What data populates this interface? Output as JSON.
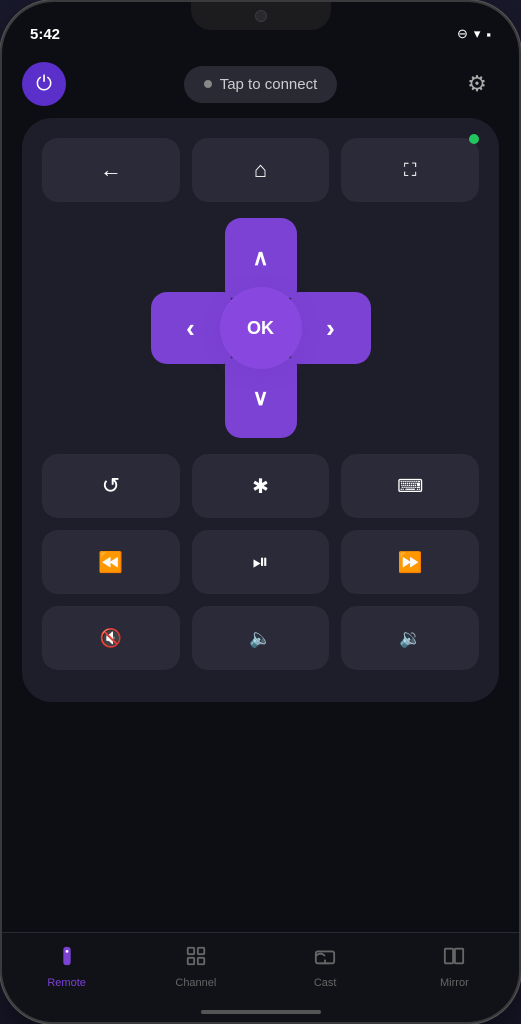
{
  "statusBar": {
    "time": "5:42",
    "icons": [
      "⊖",
      "▾",
      "▪"
    ]
  },
  "header": {
    "tapToConnect": "Tap to connect",
    "powerIcon": "⏻",
    "settingsIcon": "⚙"
  },
  "remote": {
    "navButtons": [
      {
        "icon": "←",
        "name": "back"
      },
      {
        "icon": "⌂",
        "name": "home"
      },
      {
        "icon": "⛶",
        "name": "fullscreen"
      }
    ],
    "dpad": {
      "up": "∧",
      "down": "∨",
      "left": "‹",
      "right": "›",
      "ok": "OK"
    },
    "mediaRow1": [
      {
        "icon": "↺",
        "name": "replay"
      },
      {
        "icon": "✱",
        "name": "options"
      },
      {
        "icon": "⌨",
        "name": "keyboard"
      }
    ],
    "mediaRow2": [
      {
        "icon": "«",
        "name": "rewind"
      },
      {
        "icon": "▶⏸",
        "name": "play-pause"
      },
      {
        "icon": "»",
        "name": "fast-forward"
      }
    ],
    "mediaRow3": [
      {
        "icon": "🔇",
        "name": "mute"
      },
      {
        "icon": "🔈",
        "name": "vol-down"
      },
      {
        "icon": "🔉",
        "name": "vol-up"
      }
    ]
  },
  "tabBar": {
    "tabs": [
      {
        "icon": "📺",
        "label": "Remote",
        "active": true
      },
      {
        "icon": "⊞",
        "label": "Channel",
        "active": false
      },
      {
        "icon": "⬡",
        "label": "Cast",
        "active": false
      },
      {
        "icon": "⧉",
        "label": "Mirror",
        "active": false
      }
    ]
  }
}
